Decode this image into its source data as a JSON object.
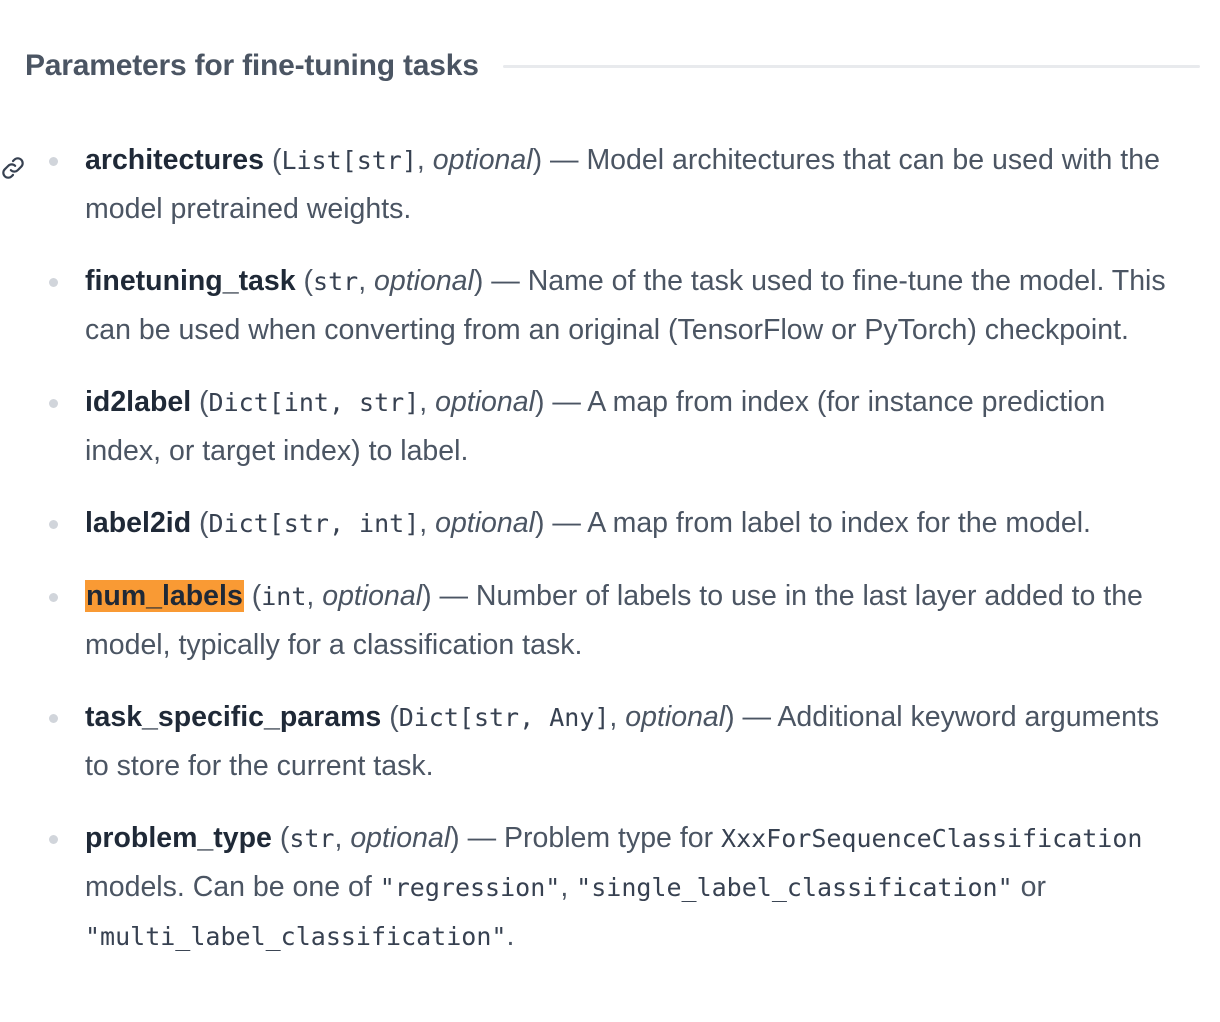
{
  "section": {
    "title": "Parameters for fine-tuning tasks"
  },
  "params": [
    {
      "name": "architectures",
      "type": "List[str]",
      "optional": "optional",
      "desc": "Model architectures that can be used with the model pretrained weights."
    },
    {
      "name": "finetuning_task",
      "type": "str",
      "optional": "optional",
      "desc": "Name of the task used to fine-tune the model. This can be used when converting from an original (TensorFlow or PyTorch) checkpoint."
    },
    {
      "name": "id2label",
      "type": "Dict[int, str]",
      "optional": "optional",
      "desc": "A map from index (for instance prediction index, or target index) to label."
    },
    {
      "name": "label2id",
      "type": "Dict[str, int]",
      "optional": "optional",
      "desc": "A map from label to index for the model."
    },
    {
      "name": "num_labels",
      "type": "int",
      "optional": "optional",
      "desc": "Number of labels to use in the last layer added to the model, typically for a classification task."
    },
    {
      "name": "task_specific_params",
      "type": "Dict[str, Any]",
      "optional": "optional",
      "desc": "Additional keyword arguments to store for the current task."
    },
    {
      "name": "problem_type",
      "type": "str",
      "optional": "optional",
      "desc_parts": {
        "a": "Problem type for",
        "code1": "XxxForSequenceClassification",
        "b": "models. Can be one of",
        "code2": "\"regression\"",
        "c": ",",
        "code3": "\"single_label_classification\"",
        "d": "or",
        "code4": "\"multi_label_classification\"",
        "e": "."
      }
    }
  ],
  "punct": {
    "open": "(",
    "comma": ", ",
    "close": ")",
    "dash": " — "
  }
}
